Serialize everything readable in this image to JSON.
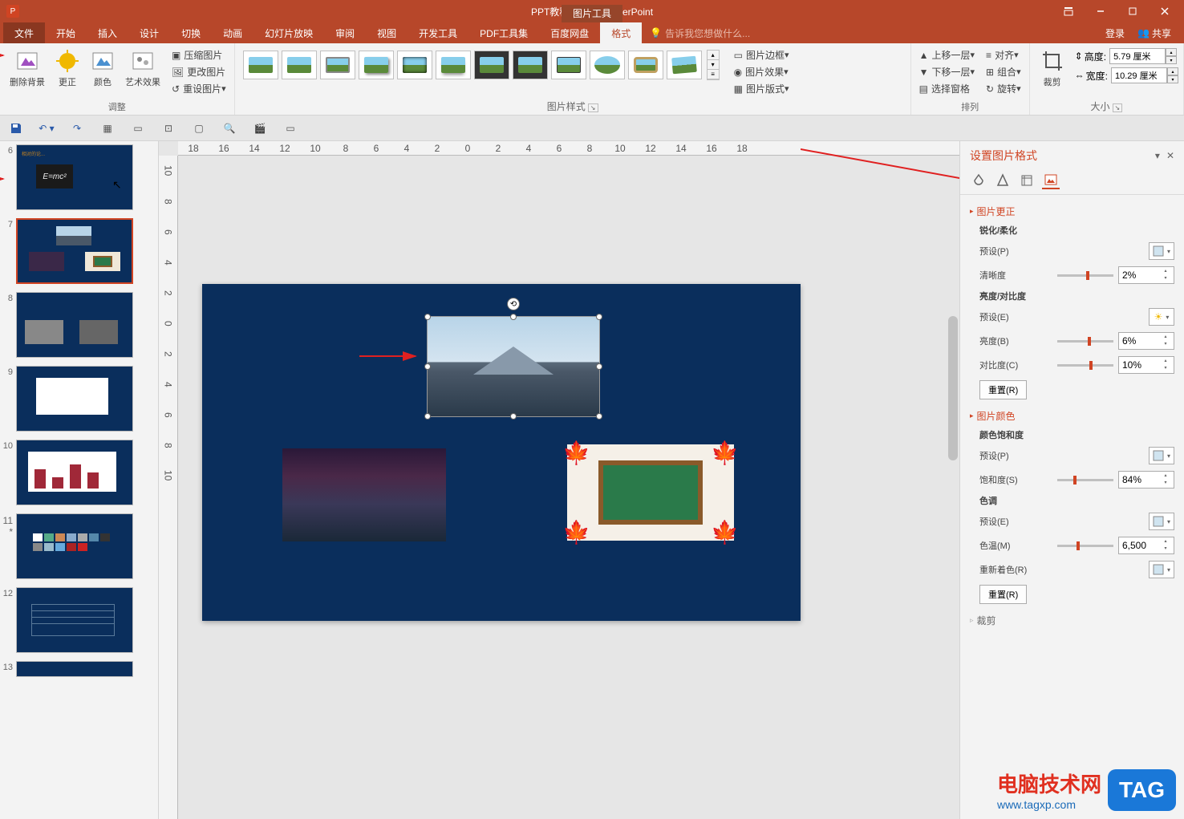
{
  "title": {
    "document": "PPT教程2.pptx - PowerPoint",
    "contextual": "图片工具"
  },
  "tabs": {
    "file": "文件",
    "items": [
      "开始",
      "插入",
      "设计",
      "切换",
      "动画",
      "幻灯片放映",
      "审阅",
      "视图",
      "开发工具",
      "PDF工具集",
      "百度网盘"
    ],
    "format": "格式",
    "tell_me": "告诉我您想做什么...",
    "login": "登录",
    "share": "共享"
  },
  "ribbon": {
    "remove_bg": "删除背景",
    "corrections": "更正",
    "color": "颜色",
    "artistic": "艺术效果",
    "compress": "压缩图片",
    "change": "更改图片",
    "reset": "重设图片",
    "adjust_group": "调整",
    "styles_group": "图片样式",
    "border": "图片边框",
    "effects": "图片效果",
    "layout": "图片版式",
    "bring_forward": "上移一层",
    "send_backward": "下移一层",
    "selection_pane": "选择窗格",
    "align": "对齐",
    "group": "组合",
    "rotate": "旋转",
    "arrange_group": "排列",
    "crop": "裁剪",
    "height_label": "高度:",
    "height_value": "5.79 厘米",
    "width_label": "宽度:",
    "width_value": "10.29 厘米",
    "size_group": "大小"
  },
  "ruler_h": [
    "18",
    "16",
    "14",
    "12",
    "10",
    "8",
    "6",
    "4",
    "2",
    "0",
    "2",
    "4",
    "6",
    "8",
    "10",
    "12",
    "14",
    "16",
    "18"
  ],
  "ruler_v": [
    "10",
    "8",
    "6",
    "4",
    "2",
    "0",
    "2",
    "4",
    "6",
    "8",
    "10"
  ],
  "thumbs": [
    {
      "n": "6"
    },
    {
      "n": "7",
      "selected": true
    },
    {
      "n": "8"
    },
    {
      "n": "9"
    },
    {
      "n": "10"
    },
    {
      "n": "11",
      "star": "*"
    },
    {
      "n": "12"
    },
    {
      "n": "13"
    }
  ],
  "pane": {
    "title": "设置图片格式",
    "sections": {
      "correction": "图片更正",
      "sharpen": "锐化/柔化",
      "preset_p": "预设(P)",
      "sharpness": "清晰度",
      "sharpness_val": "2%",
      "brightness_contrast": "亮度/对比度",
      "preset_e": "预设(E)",
      "brightness": "亮度(B)",
      "brightness_val": "6%",
      "contrast": "对比度(C)",
      "contrast_val": "10%",
      "reset_r": "重置(R)",
      "color": "图片颜色",
      "saturation_header": "颜色饱和度",
      "saturation": "饱和度(S)",
      "saturation_val": "84%",
      "tone": "色调",
      "preset_e2": "预设(E)",
      "temp": "色温(M)",
      "temp_val": "6,500",
      "recolor": "重新着色(R)",
      "crop": "裁剪"
    }
  },
  "watermark": {
    "text": "电脑技术网",
    "url": "www.tagxp.com",
    "tag": "TAG"
  }
}
